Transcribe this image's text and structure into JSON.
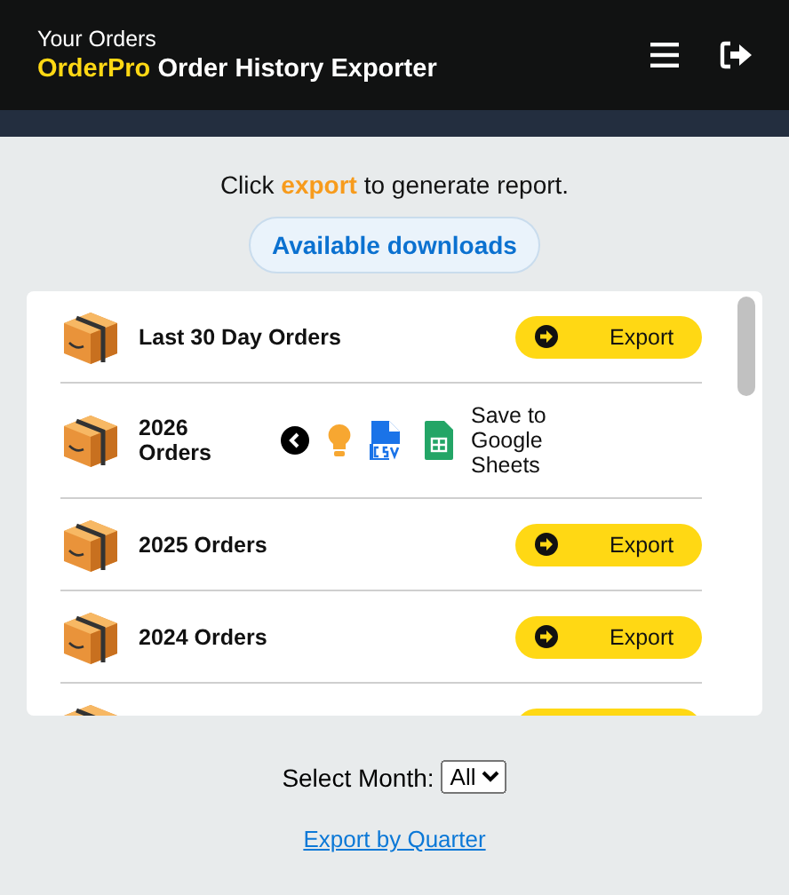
{
  "header": {
    "subtitle": "Your Orders",
    "brand": "OrderPro",
    "title": "Order History Exporter"
  },
  "intro": "Click **export** to generate report.",
  "downloads_button": "Available downloads",
  "rows": [
    {
      "kind": "export",
      "label": "Last 30 Day Orders",
      "button": "Export"
    },
    {
      "kind": "expanded",
      "label": "2026 Orders",
      "save_label": "Save to Google Sheets"
    },
    {
      "kind": "export",
      "label": "2025 Orders",
      "button": "Export"
    },
    {
      "kind": "export",
      "label": "2024 Orders",
      "button": "Export"
    },
    {
      "kind": "export"
    }
  ],
  "month_select": {
    "label": "Select Month:",
    "value": "All"
  },
  "quarter_link": "Export by Quarter"
}
